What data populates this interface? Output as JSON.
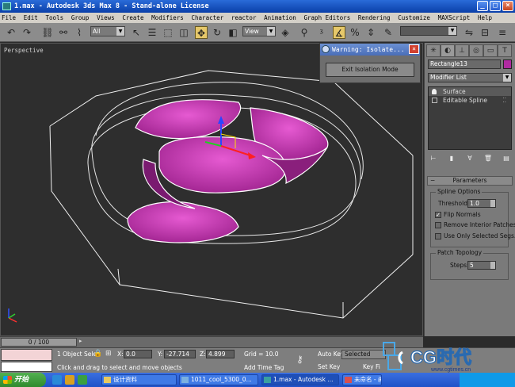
{
  "window": {
    "title": "1.max - Autodesk 3ds Max 8 - Stand-alone License",
    "buttons": [
      "_",
      "□",
      "×"
    ]
  },
  "menu": [
    "File",
    "Edit",
    "Tools",
    "Group",
    "Views",
    "Create",
    "Modifiers",
    "Character",
    "reactor",
    "Animation",
    "Graph Editors",
    "Rendering",
    "Customize",
    "MAXScript",
    "Help"
  ],
  "toolbar": {
    "selection_filter": "All",
    "reference_coord": "View"
  },
  "viewport": {
    "label": "Perspective"
  },
  "dialog": {
    "title": "Warning: Isolate...",
    "close": "×",
    "button_label": "Exit Isolation Mode"
  },
  "command_panel": {
    "object_name": "Rectangle13",
    "modifier_list": "Modifier List",
    "stack": [
      {
        "label": "Surface",
        "selected": true
      },
      {
        "label": "Editable Spline",
        "selected": false
      }
    ],
    "parameters_title": "Parameters",
    "spline_options_title": "Spline Options",
    "threshold_label": "Threshold:",
    "threshold_value": "1.0",
    "flip_normals_label": "Flip Normals",
    "flip_normals_checked": true,
    "remove_interior_label": "Remove Interior Patches",
    "remove_interior_checked": false,
    "use_only_selected_label": "Use Only Selected Segs.",
    "use_only_selected_checked": false,
    "patch_topology_title": "Patch Topology",
    "steps_label": "Steps:",
    "steps_value": "5",
    "object_color": "#b02aa0",
    "tabs": [
      "create",
      "modify",
      "hierarchy",
      "motion",
      "display",
      "utilities"
    ]
  },
  "timeslider": {
    "label": "0 / 100"
  },
  "status": {
    "selection": "1 Object Sele",
    "x_label": "X:",
    "x_value": "0.0",
    "y_label": "Y:",
    "y_value": "-27.714",
    "z_label": "Z:",
    "z_value": "4.899",
    "grid": "Grid = 10.0",
    "prompt": "Click and drag to select and move objects",
    "add_time_tag": "Add Time Tag",
    "auto_key": "Auto Key",
    "auto_key_value": "Selected",
    "set_key": "Set Key",
    "key_filters": "Key Fi"
  },
  "watermark": {
    "brand": "CG时代",
    "url": "www.cgtimes.cn"
  },
  "taskbar": {
    "start": "开始",
    "tasks": [
      {
        "label": "设计资料",
        "active": false
      },
      {
        "label": "1011_cool_5300_0...",
        "active": false
      },
      {
        "label": "1.max - Autodesk ...",
        "active": true
      },
      {
        "label": "未命名 - 画图",
        "active": false
      }
    ]
  },
  "colors": {
    "surface_magenta": "#c52eb0",
    "viewport_bg": "#2e2e2e",
    "ui_gray": "#7a7a7a",
    "title_blue": "#0a3fa8"
  }
}
